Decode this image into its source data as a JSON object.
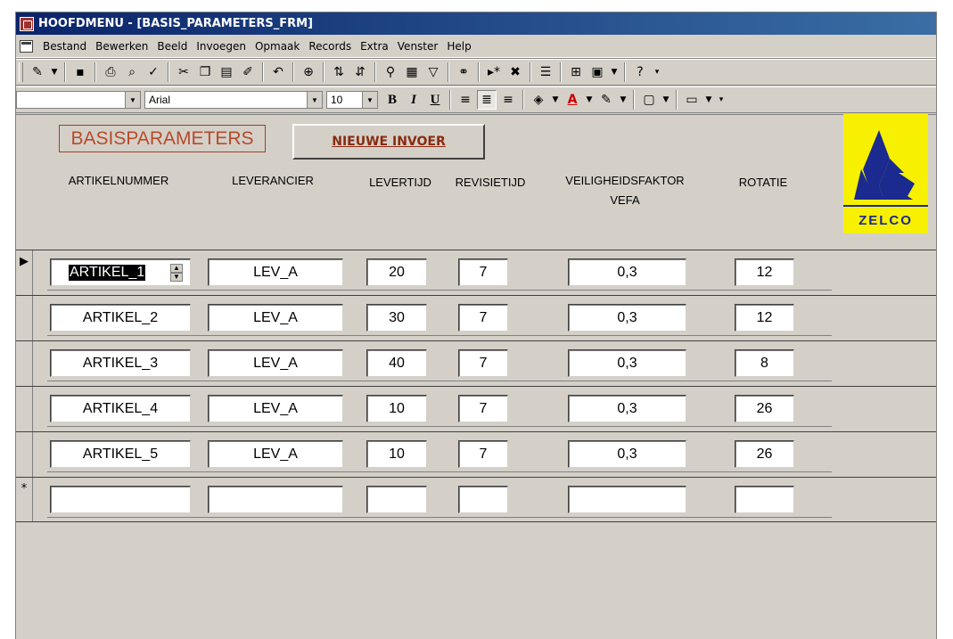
{
  "window": {
    "title": "HOOFDMENU - [BASIS_PARAMETERS_FRM]"
  },
  "menu": [
    "Bestand",
    "Bewerken",
    "Beeld",
    "Invoegen",
    "Opmaak",
    "Records",
    "Extra",
    "Venster",
    "Help"
  ],
  "format_toolbar": {
    "font_name": "Arial",
    "font_size": "10"
  },
  "form": {
    "title": "BASISPARAMETERS",
    "new_button": "NIEUWE INVOER",
    "logo_text": "ZELCO",
    "headers": {
      "artikelnummer": "ARTIKELNUMMER",
      "leverancier": "LEVERANCIER",
      "levertijd": "LEVERTIJD",
      "revisietijd": "REVISIETIJD",
      "veiligheid": "VEILIGHEIDSFAKTOR",
      "vefa": "VEFA",
      "rotatie": "ROTATIE"
    }
  },
  "records": [
    {
      "artikel": "ARTIKEL_1",
      "leverancier": "LEV_A",
      "levertijd": "20",
      "revisietijd": "7",
      "vefa": "0,3",
      "rotatie": "12"
    },
    {
      "artikel": "ARTIKEL_2",
      "leverancier": "LEV_A",
      "levertijd": "30",
      "revisietijd": "7",
      "vefa": "0,3",
      "rotatie": "12"
    },
    {
      "artikel": "ARTIKEL_3",
      "leverancier": "LEV_A",
      "levertijd": "40",
      "revisietijd": "7",
      "vefa": "0,3",
      "rotatie": "8"
    },
    {
      "artikel": "ARTIKEL_4",
      "leverancier": "LEV_A",
      "levertijd": "10",
      "revisietijd": "7",
      "vefa": "0,3",
      "rotatie": "26"
    },
    {
      "artikel": "ARTIKEL_5",
      "leverancier": "LEV_A",
      "levertijd": "10",
      "revisietijd": "7",
      "vefa": "0,3",
      "rotatie": "26"
    }
  ],
  "new_record_marker": "*",
  "current_record_marker": "▶"
}
